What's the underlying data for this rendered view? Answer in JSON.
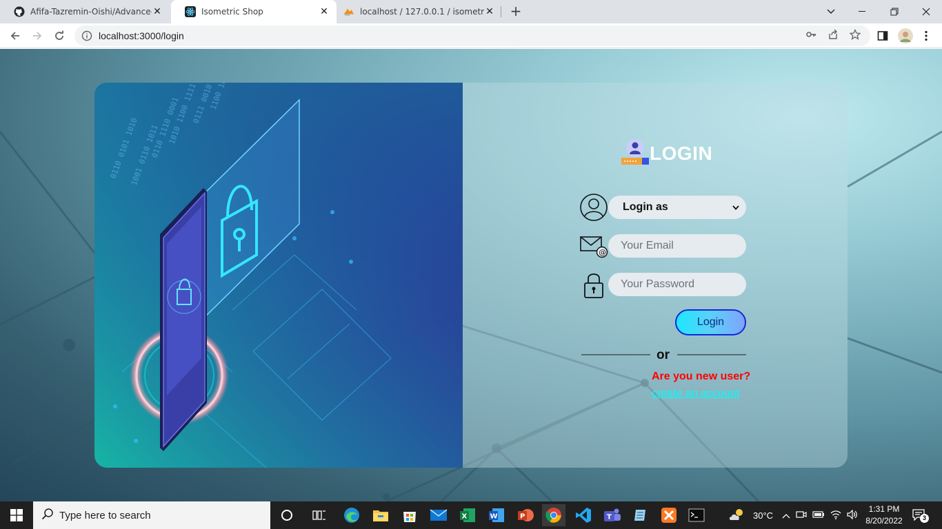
{
  "browser": {
    "tabs": [
      {
        "title": "Afifa-Tazremin-Oishi/Advance-W",
        "favicon": "github-icon",
        "active": false
      },
      {
        "title": "Isometric Shop",
        "favicon": "react-icon",
        "active": true
      },
      {
        "title": "localhost / 127.0.0.1 / isometric_",
        "favicon": "phpmyadmin-icon",
        "active": false
      }
    ],
    "url": "localhost:3000/login"
  },
  "login": {
    "title": "LOGIN",
    "role_select": {
      "selected": "Login as"
    },
    "email": {
      "placeholder": "Your Email"
    },
    "password": {
      "placeholder": "Your Password"
    },
    "submit_label": "Login",
    "or_text": "or",
    "new_user_text": "Are you new user?",
    "create_account_text": "create an account"
  },
  "taskbar": {
    "search_placeholder": "Type here to search",
    "weather": "30°C",
    "time": "1:31 PM",
    "date": "8/20/2022",
    "notifications": "3"
  },
  "colors": {
    "login_button": "#1fe7ff",
    "new_user_text": "#ff0000",
    "create_link": "#00ffff"
  }
}
